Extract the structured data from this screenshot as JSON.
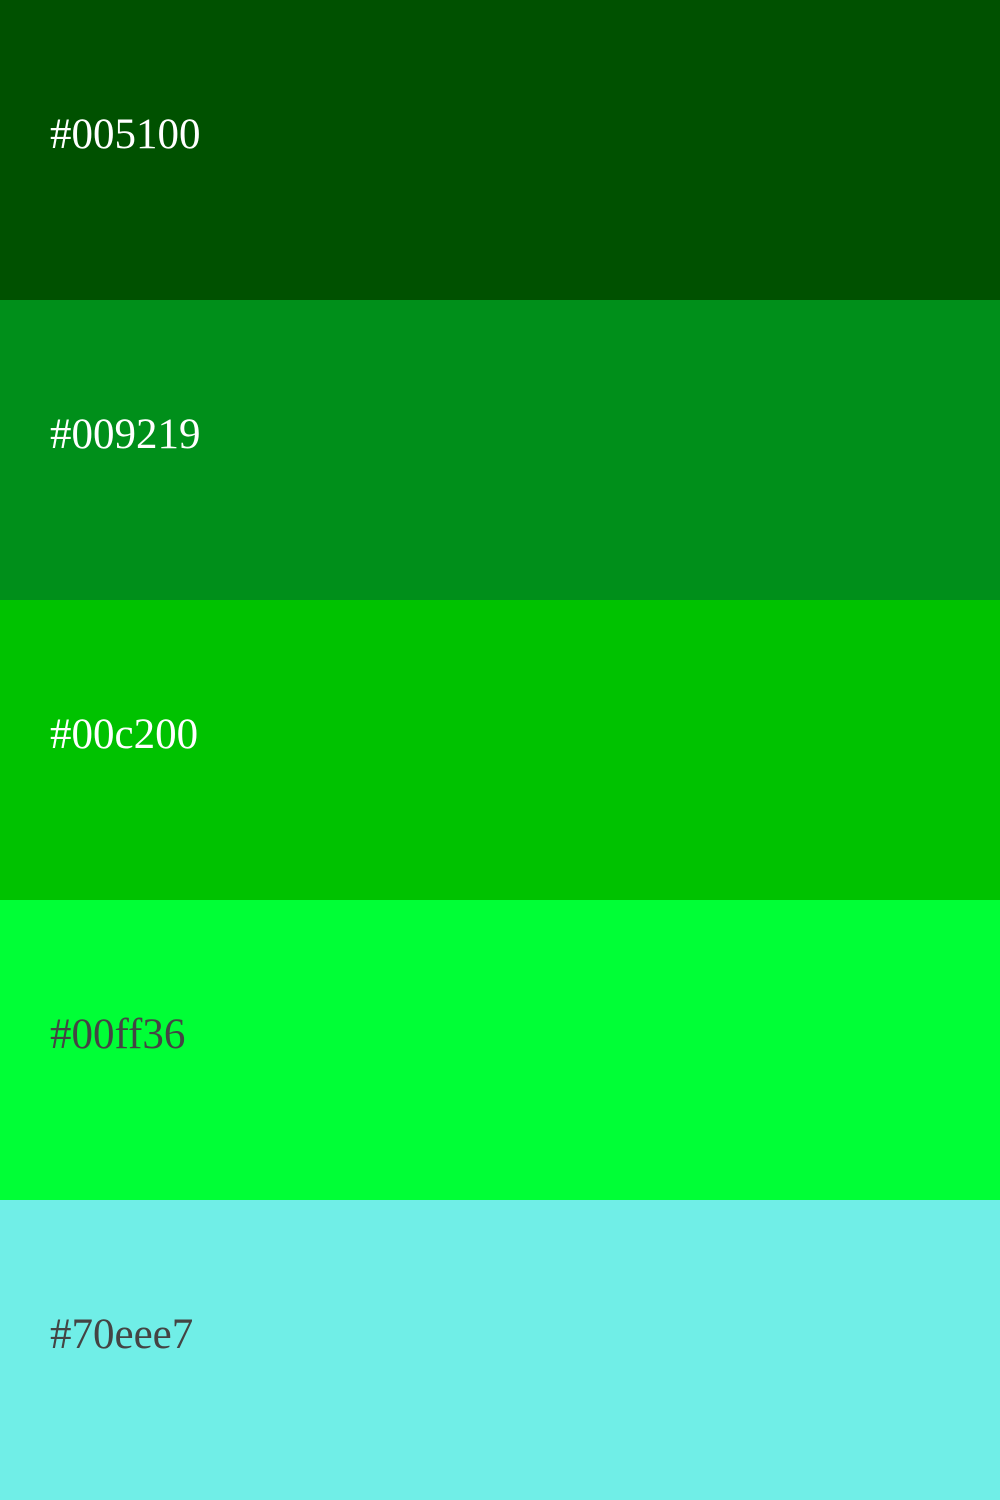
{
  "swatches": [
    {
      "label": "#005100",
      "color": "#005100",
      "text_color": "#ffffff"
    },
    {
      "label": "#009219",
      "color": "#008f1a",
      "text_color": "#ffffff"
    },
    {
      "label": "#00c200",
      "color": "#00c200",
      "text_color": "#ffffff"
    },
    {
      "label": "#00ff36",
      "color": "#00ff36",
      "text_color": "#444444"
    },
    {
      "label": "#70eee7",
      "color": "#70eee7",
      "text_color": "#444444"
    }
  ]
}
